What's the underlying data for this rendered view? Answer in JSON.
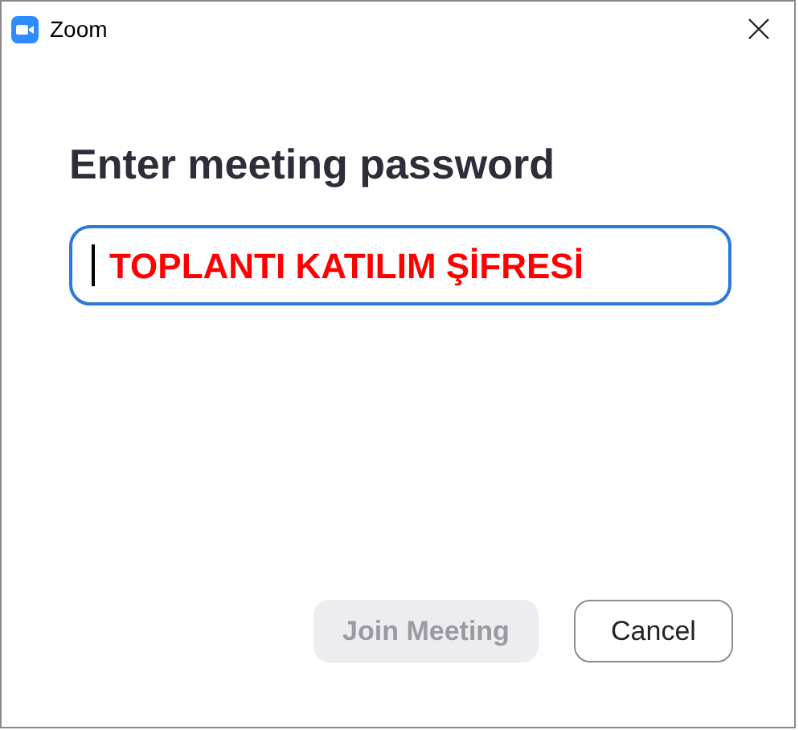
{
  "window": {
    "title": "Zoom"
  },
  "heading": "Enter meeting password",
  "password_field": {
    "value": "TOPLANTI KATILIM ŞİFRESİ",
    "focused": true
  },
  "buttons": [
    {
      "label": "Join Meeting",
      "kind": "primary",
      "disabled": true
    },
    {
      "label": "Cancel",
      "kind": "secondary",
      "disabled": false
    }
  ]
}
